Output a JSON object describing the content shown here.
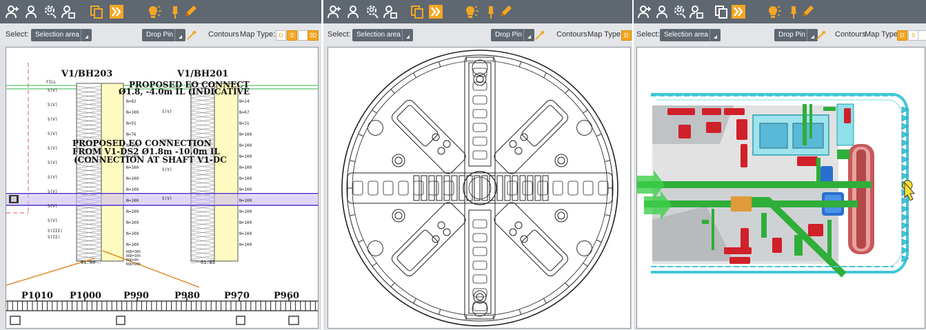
{
  "panels": [
    {
      "id": "borehole",
      "option_bar": {
        "select_label": "Select:",
        "selection_dropdown": "Selection area",
        "drop_pin_label": "Drop Pin",
        "contours_label": "Contours",
        "map_type_label": "Map Type:",
        "map_types": [
          {
            "label": "D",
            "active": false
          },
          {
            "label": "S",
            "active": true
          },
          {
            "label": "",
            "active": false
          },
          {
            "label": "3D",
            "active": true
          }
        ]
      },
      "drawing": {
        "borehole_titles": [
          "V1/BH203",
          "V1/BH201"
        ],
        "fill_label": "FILL",
        "annotation_lines": [
          "PROPOSED EO CONNECT",
          "Ø1.8, -4.0m IL (INDICATIVE",
          "PROPOSED EO CONNECTION",
          "FROM V1-DS2 Ø1.8m -10.0m IL",
          "(CONNECTION AT SHAFT V1-DC"
        ],
        "soil_labels": [
          "S(V)",
          "S(V)",
          "S(V)",
          "S(V)",
          "S(V)",
          "S(V)",
          "S(V)",
          "S(V)",
          "S(V)",
          "S(V)",
          "S(III)",
          "S(II)"
        ],
        "n_values_left": [
          "N=82",
          "N=100",
          "N=55",
          "N=76",
          "N=100",
          "N=100",
          "N=100",
          "N=100",
          "N=100",
          "N=100",
          "N=100",
          "N=100",
          "N=100",
          "N=100"
        ],
        "n_values_right": [
          "N=24",
          "N=67",
          "N=31",
          "N=100",
          "N=100",
          "N=100",
          "N=100",
          "N=100",
          "N=100",
          "N=100",
          "N=100",
          "N=100",
          "N=100",
          "N=100"
        ],
        "rqd_values": [
          "RQD=38%",
          "RQD=16%",
          "RQD=0%",
          "RQD=20%"
        ],
        "depth_labels": [
          "61.00",
          "61.05"
        ],
        "chainage_labels": [
          "P1010",
          "P1000",
          "P990",
          "P980",
          "P970",
          "P960"
        ]
      }
    },
    {
      "id": "cutterhead",
      "option_bar": {
        "select_label": "Select:",
        "selection_dropdown": "Selection area",
        "drop_pin_label": "Drop Pin",
        "contours_label": "Contours",
        "map_type_label": "Map Type:",
        "map_types": [
          {
            "label": "D",
            "active": true
          }
        ]
      }
    },
    {
      "id": "tbm-section",
      "option_bar": {
        "select_label": "Select:",
        "selection_dropdown": "Selection area",
        "drop_pin_label": "Drop Pin",
        "contours_label": "Contours",
        "map_type_label": "Map Type:",
        "map_types": [
          {
            "label": "D",
            "active": true
          },
          {
            "label": "S",
            "active": false
          },
          {
            "label": "",
            "active": false
          }
        ]
      }
    }
  ],
  "toolbar_icons": [
    "add-person-icon",
    "person-icon",
    "person-search-icon",
    "person-link-icon",
    "copy-icon",
    "forward-icon",
    "lightbulb-icon",
    "pin-icon",
    "pencil-icon"
  ],
  "colors": {
    "toolbar": "#5f6771",
    "accent": "#f5a623",
    "borehole_fill": "#fffbc0",
    "highlight_band": "#7a5bd6",
    "tbm_teal": "#3fc8d8",
    "tbm_green": "#2fae3a",
    "tbm_red": "#d0202a"
  }
}
